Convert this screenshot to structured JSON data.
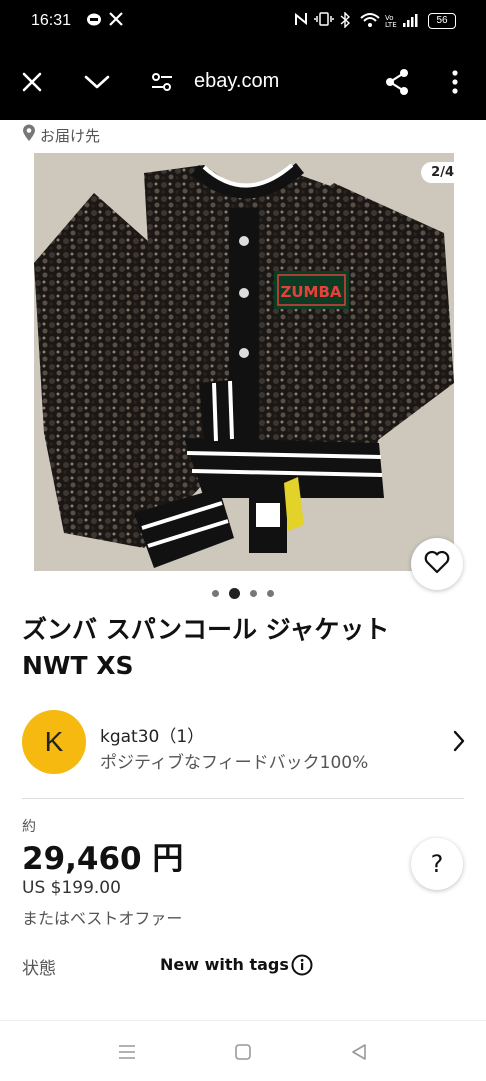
{
  "status_bar": {
    "time": "16:31",
    "battery": "56"
  },
  "browser": {
    "url": "ebay.com"
  },
  "location": {
    "label": "お届け先"
  },
  "gallery": {
    "counter": "2/4",
    "badge_text": "ZUMBA",
    "dots": 4,
    "active_dot": 2
  },
  "item": {
    "title_line1": "ズンバ スパンコール ジャケット",
    "title_line2": "NWT XS"
  },
  "seller": {
    "initial": "K",
    "name": "kgat30（1）",
    "feedback": "ポジティブなフィードバック100%"
  },
  "price": {
    "approx_label": "約",
    "jpy": "29,460 円",
    "usd": "US $199.00",
    "best_offer": "またはベストオファー"
  },
  "condition": {
    "label": "状態",
    "value": "New with tags"
  },
  "help": {
    "label": "?"
  },
  "colors": {
    "avatar": "#f5b90f",
    "bars": "#000000"
  }
}
